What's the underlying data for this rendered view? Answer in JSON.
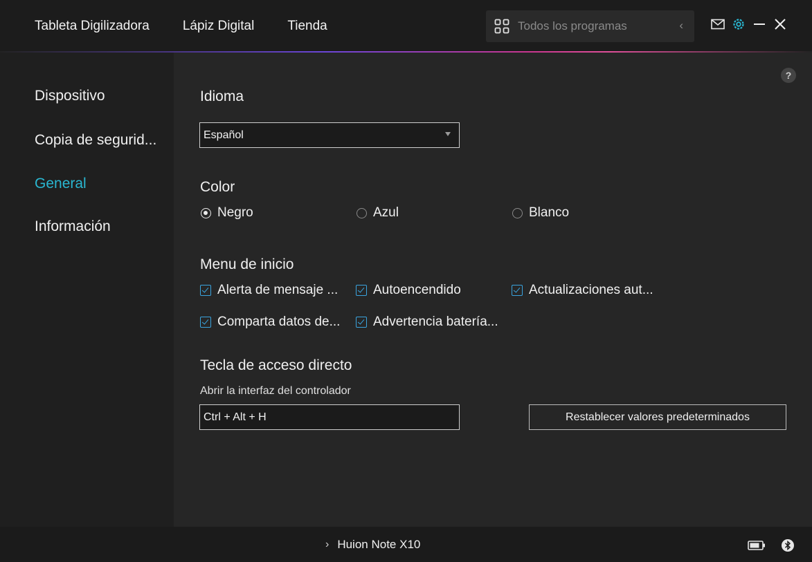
{
  "topbar": {
    "nav": [
      "Tableta Digilizadora",
      "Lápiz Digital",
      "Tienda"
    ],
    "programs_label": "Todos los programas",
    "icons": [
      "grid-icon",
      "chevron-left-icon",
      "mail-icon",
      "gear-icon",
      "minimize-icon",
      "close-icon"
    ]
  },
  "sidebar": {
    "items": [
      {
        "label": "Dispositivo"
      },
      {
        "label": "Copia de segurid..."
      },
      {
        "label": "General",
        "active": true
      },
      {
        "label": "Información"
      }
    ]
  },
  "general": {
    "language": {
      "title": "Idioma",
      "selected": "Español"
    },
    "color": {
      "title": "Color",
      "options": [
        {
          "label": "Negro",
          "selected": true
        },
        {
          "label": "Azul",
          "selected": false
        },
        {
          "label": "Blanco",
          "selected": false
        }
      ]
    },
    "startup": {
      "title": "Menu de inicio",
      "options": [
        {
          "label": "Alerta de mensaje ...",
          "checked": true
        },
        {
          "label": "Autoencendido",
          "checked": true
        },
        {
          "label": "Actualizaciones aut...",
          "checked": true
        },
        {
          "label": "Comparta datos de...",
          "checked": true
        },
        {
          "label": "Advertencia batería...",
          "checked": true
        }
      ]
    },
    "hotkey": {
      "title": "Tecla de acceso directo",
      "sublabel": "Abrir la interfaz del controlador",
      "value": "Ctrl + Alt + H",
      "reset_label": "Restablecer valores predeterminados"
    }
  },
  "bottombar": {
    "device": "Huion Note X10"
  },
  "colors": {
    "accent": "#2ab7d1",
    "check": "#3aa5e0",
    "gear": "#2ab7d1"
  }
}
